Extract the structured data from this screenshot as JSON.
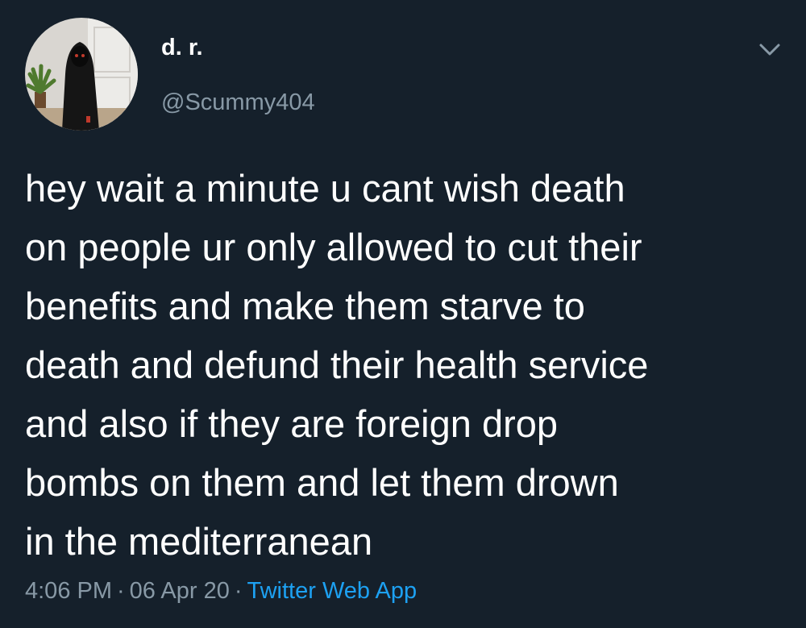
{
  "tweet": {
    "display_name": "d. r.",
    "handle": "@Scummy404",
    "text": "hey wait a minute u cant wish death\non people ur only allowed to cut their\nbenefits and make them starve to\ndeath and defund their health service\nand also if they are foreign drop\nbombs on them and let them drown\nin the mediterranean",
    "time": "4:06 PM",
    "date": "06 Apr 20",
    "separator": "·",
    "source": "Twitter Web App"
  },
  "icons": {
    "menu": "chevron-down-icon",
    "avatar": "profile-picture"
  },
  "colors": {
    "background": "#15202b",
    "primary_text": "#ffffff",
    "secondary_text": "#8899a6",
    "link": "#1da1f2"
  }
}
